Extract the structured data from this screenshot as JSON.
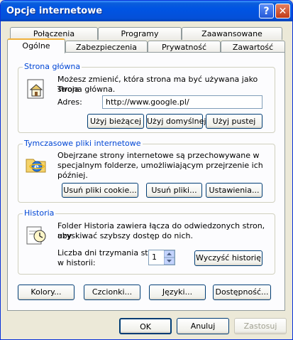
{
  "window": {
    "title": "Opcje internetowe",
    "help_label": "?",
    "close_label": "✕"
  },
  "tabs": {
    "back": [
      "Połączenia",
      "Programy",
      "Zaawansowane"
    ],
    "front": [
      "Ogólne",
      "Zabezpieczenia",
      "Prywatność",
      "Zawartość"
    ],
    "active": "Ogólne"
  },
  "home": {
    "title": "Strona główna",
    "desc1": "Możesz zmienić, która strona ma być używana jako Twoja",
    "desc2": "strona główna.",
    "address_label": "Adres:",
    "address_value": "http://www.google.pl/",
    "btn_current": "Użyj bieżącej",
    "btn_default": "Użyj domyślnej",
    "btn_blank": "Użyj pustej"
  },
  "temp": {
    "title": "Tymczasowe pliki internetowe",
    "desc1": "Obejrzane strony internetowe są przechowywane w",
    "desc2": "specjalnym folderze, umożliwiającym przejrzenie ich później.",
    "btn_cookies": "Usuń pliki cookie...",
    "btn_files": "Usuń pliki...",
    "btn_settings": "Ustawienia..."
  },
  "history": {
    "title": "Historia",
    "desc1": "Folder Historia zawiera łącza do odwiedzonych stron, aby",
    "desc2": "uzyskiwać szybszy dostęp do nich.",
    "days_label1": "Liczba dni trzymania stron",
    "days_label2": "w historii:",
    "days_value": "1",
    "btn_clear": "Wyczyść historię"
  },
  "bottom": {
    "colors": "Kolory...",
    "fonts": "Czcionki...",
    "languages": "Języki...",
    "accessibility": "Dostępność..."
  },
  "footer": {
    "ok": "OK",
    "cancel": "Anuluj",
    "apply": "Zastosuj"
  },
  "colors": {
    "titlebar": "#0054e3",
    "group_title": "#0046d5",
    "dialog_bg": "#ece9d8",
    "tab_highlight": "#f0b13b"
  },
  "icons": [
    "help-icon",
    "close-icon",
    "home-page-icon",
    "ie-folder-icon",
    "history-clock-icon",
    "spin-up-icon",
    "spin-down-icon"
  ]
}
